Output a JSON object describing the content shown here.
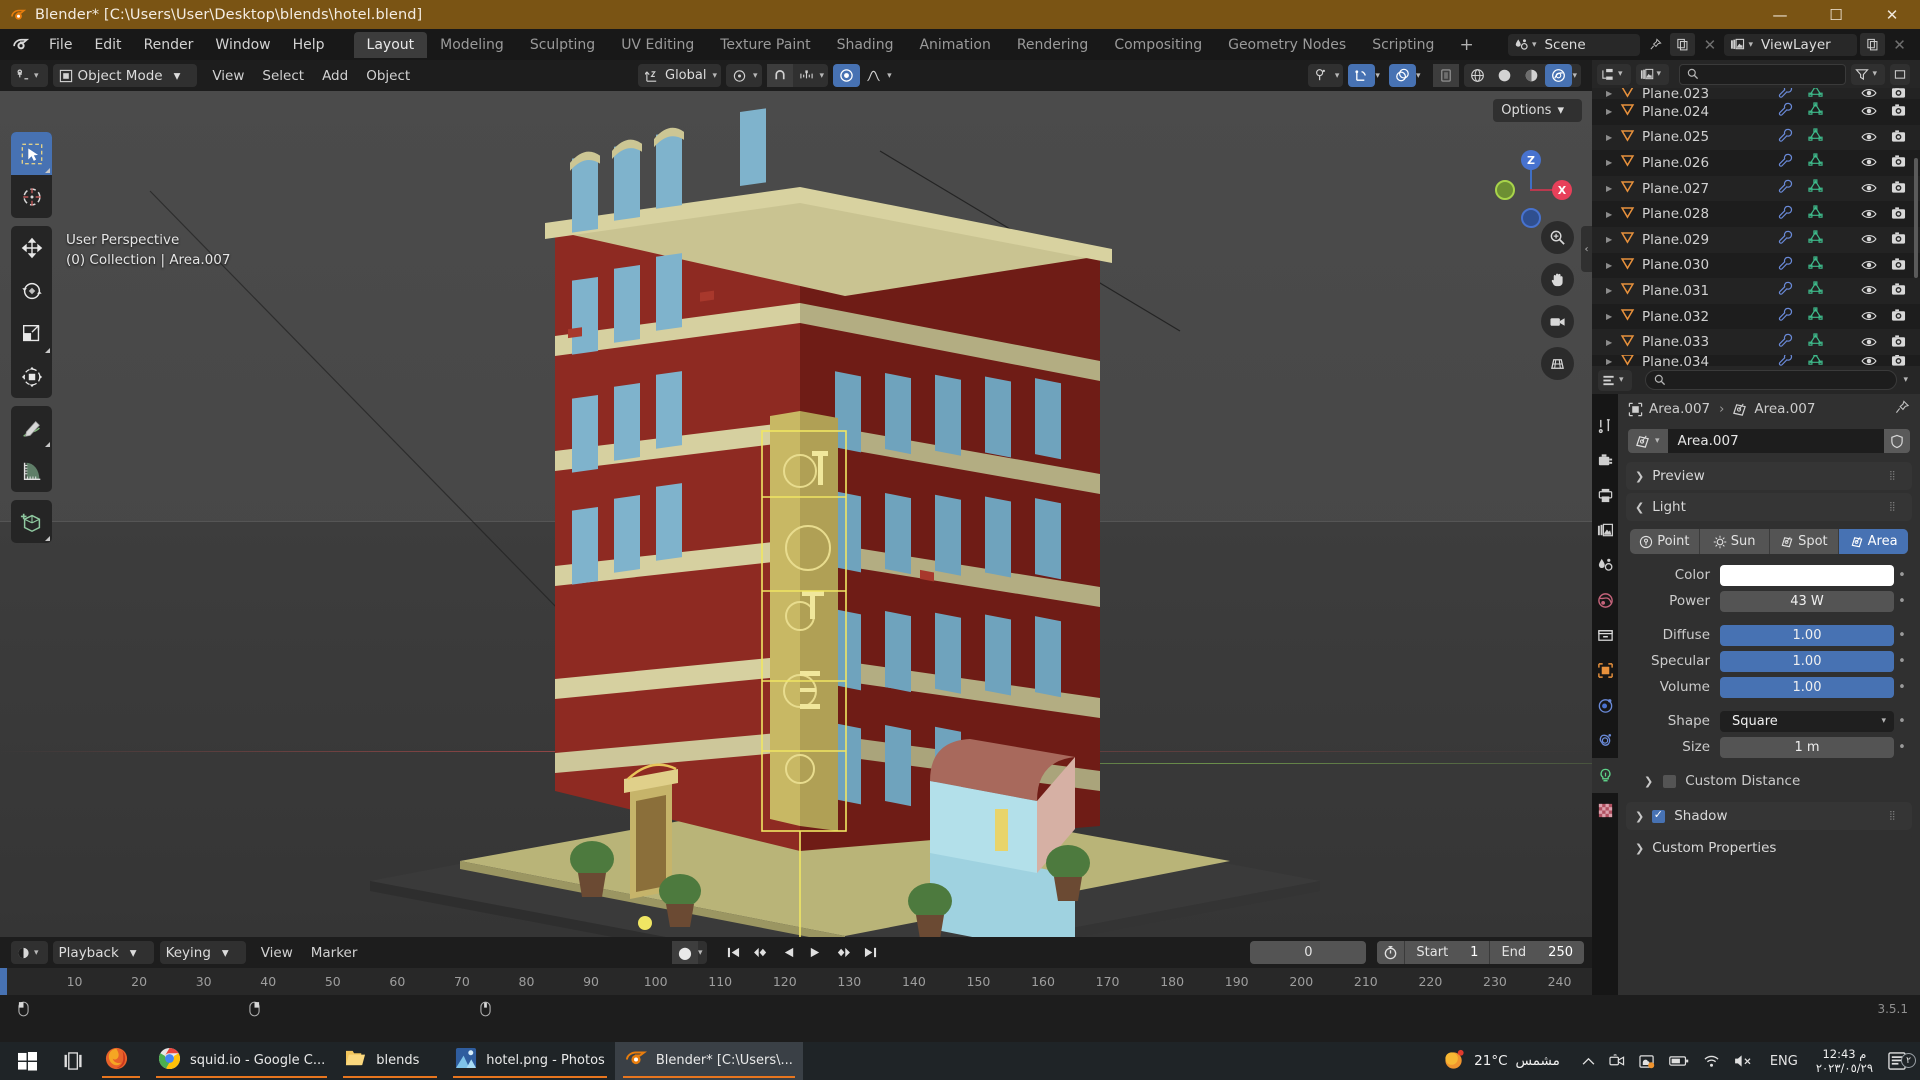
{
  "window": {
    "title": "Blender* [C:\\Users\\User\\Desktop\\blends\\hotel.blend]",
    "minimize": "—",
    "maximize": "☐",
    "close": "✕",
    "titlebar_color": "#7a5414"
  },
  "menu": {
    "items": [
      "File",
      "Edit",
      "Render",
      "Window",
      "Help"
    ],
    "workspaces": [
      {
        "label": "Layout",
        "active": true
      },
      {
        "label": "Modeling",
        "active": false
      },
      {
        "label": "Sculpting",
        "active": false
      },
      {
        "label": "UV Editing",
        "active": false
      },
      {
        "label": "Texture Paint",
        "active": false
      },
      {
        "label": "Shading",
        "active": false
      },
      {
        "label": "Animation",
        "active": false
      },
      {
        "label": "Rendering",
        "active": false
      },
      {
        "label": "Compositing",
        "active": false
      },
      {
        "label": "Geometry Nodes",
        "active": false
      },
      {
        "label": "Scripting",
        "active": false
      }
    ],
    "add_workspace": "+",
    "scene_name": "Scene",
    "viewlayer_name": "ViewLayer"
  },
  "viewport_header": {
    "editor_type": "editor-type-3dview",
    "mode": "Object Mode",
    "menus": [
      "View",
      "Select",
      "Add",
      "Object"
    ],
    "transform_orientation": "Global",
    "options_label": "Options"
  },
  "viewport": {
    "perspective": "User Perspective",
    "collection_info": "(0) Collection | Area.007",
    "gizmo_axes": [
      {
        "label": "Z",
        "color": "#4772cf"
      },
      {
        "label": "X",
        "color": "#e8405a"
      },
      {
        "label": "Y",
        "color": "#8fc440"
      }
    ],
    "tools": [
      {
        "name": "tweak-select-box",
        "active": true
      },
      {
        "name": "cursor",
        "active": false
      },
      {
        "name": "move",
        "active": false
      },
      {
        "name": "rotate",
        "active": false
      },
      {
        "name": "scale",
        "active": false
      },
      {
        "name": "transform",
        "active": false
      },
      {
        "name": "annotate",
        "active": false
      },
      {
        "name": "measure",
        "active": false
      },
      {
        "name": "add-cube",
        "active": false
      }
    ],
    "nav_buttons": [
      "zoom",
      "pan",
      "camera-view",
      "toggle-ortho"
    ]
  },
  "timeline": {
    "editor_type": "editor-type-timeline",
    "menus": [
      "Playback",
      "Keying",
      "View",
      "Marker"
    ],
    "current_frame": "0",
    "start_label": "Start",
    "start_value": "1",
    "end_label": "End",
    "end_value": "250",
    "ticks": [
      10,
      20,
      30,
      40,
      50,
      60,
      70,
      80,
      90,
      100,
      110,
      120,
      130,
      140,
      150,
      160,
      170,
      180,
      190,
      200,
      210,
      220,
      230,
      240
    ]
  },
  "outliner": {
    "search_placeholder": "",
    "rows": [
      {
        "name": "Plane.024"
      },
      {
        "name": "Plane.025"
      },
      {
        "name": "Plane.026"
      },
      {
        "name": "Plane.027"
      },
      {
        "name": "Plane.028"
      },
      {
        "name": "Plane.029"
      },
      {
        "name": "Plane.030"
      },
      {
        "name": "Plane.031"
      },
      {
        "name": "Plane.032"
      },
      {
        "name": "Plane.033"
      }
    ],
    "row_top_partial": "Plane.023",
    "row_bottom_partial": "Plane.034"
  },
  "properties": {
    "breadcrumb_object": "Area.007",
    "breadcrumb_data": "Area.007",
    "id_name": "Area.007",
    "panels": [
      {
        "label": "Preview",
        "expanded": false
      },
      {
        "label": "Light",
        "expanded": true
      }
    ],
    "light_types": [
      {
        "label": "Point",
        "active": false
      },
      {
        "label": "Sun",
        "active": false
      },
      {
        "label": "Spot",
        "active": false
      },
      {
        "label": "Area",
        "active": true
      }
    ],
    "fields": [
      {
        "label": "Color",
        "value": "",
        "style": "white"
      },
      {
        "label": "Power",
        "value": "43 W",
        "style": "gray"
      },
      {
        "label": "Diffuse",
        "value": "1.00",
        "style": "blue"
      },
      {
        "label": "Specular",
        "value": "1.00",
        "style": "blue"
      },
      {
        "label": "Volume",
        "value": "1.00",
        "style": "blue"
      },
      {
        "label": "Shape",
        "value": "Square",
        "style": "dark"
      },
      {
        "label": "Size",
        "value": "1 m",
        "style": "gray"
      }
    ],
    "custom_distance_label": "Custom Distance",
    "shadow_label": "Shadow",
    "shadow_checked": true,
    "custom_properties_label": "Custom Properties",
    "tabs": [
      {
        "name": "tool",
        "active": false
      },
      {
        "name": "render",
        "active": false
      },
      {
        "name": "output",
        "active": false
      },
      {
        "name": "view-layer",
        "active": false
      },
      {
        "name": "scene",
        "active": false
      },
      {
        "name": "world",
        "active": false
      },
      {
        "name": "collection",
        "active": false
      },
      {
        "name": "object",
        "active": false
      },
      {
        "name": "modifiers",
        "active": false
      },
      {
        "name": "physics",
        "active": false
      },
      {
        "name": "object-data-light",
        "active": true
      },
      {
        "name": "material",
        "active": false
      }
    ]
  },
  "statusbar": {
    "version": "3.5.1"
  },
  "taskbar": {
    "apps": [
      {
        "label": "",
        "icon": "firefox-icon",
        "running": false,
        "active": false
      },
      {
        "label": "squid.io - Google C...",
        "icon": "chrome-icon",
        "running": true,
        "active": false
      },
      {
        "label": "blends",
        "icon": "folder-icon",
        "running": true,
        "active": false
      },
      {
        "label": "hotel.png - Photos",
        "icon": "photos-icon",
        "running": true,
        "active": false
      },
      {
        "label": "Blender* [C:\\Users\\...",
        "icon": "blender-icon",
        "running": true,
        "active": true
      }
    ],
    "weather_temp": "21°C",
    "weather_desc": "مشمس",
    "language": "ENG",
    "time": "12:43 م",
    "date": "٢٠٢٣/٠٥/٢٩",
    "notification_count": "٢"
  }
}
